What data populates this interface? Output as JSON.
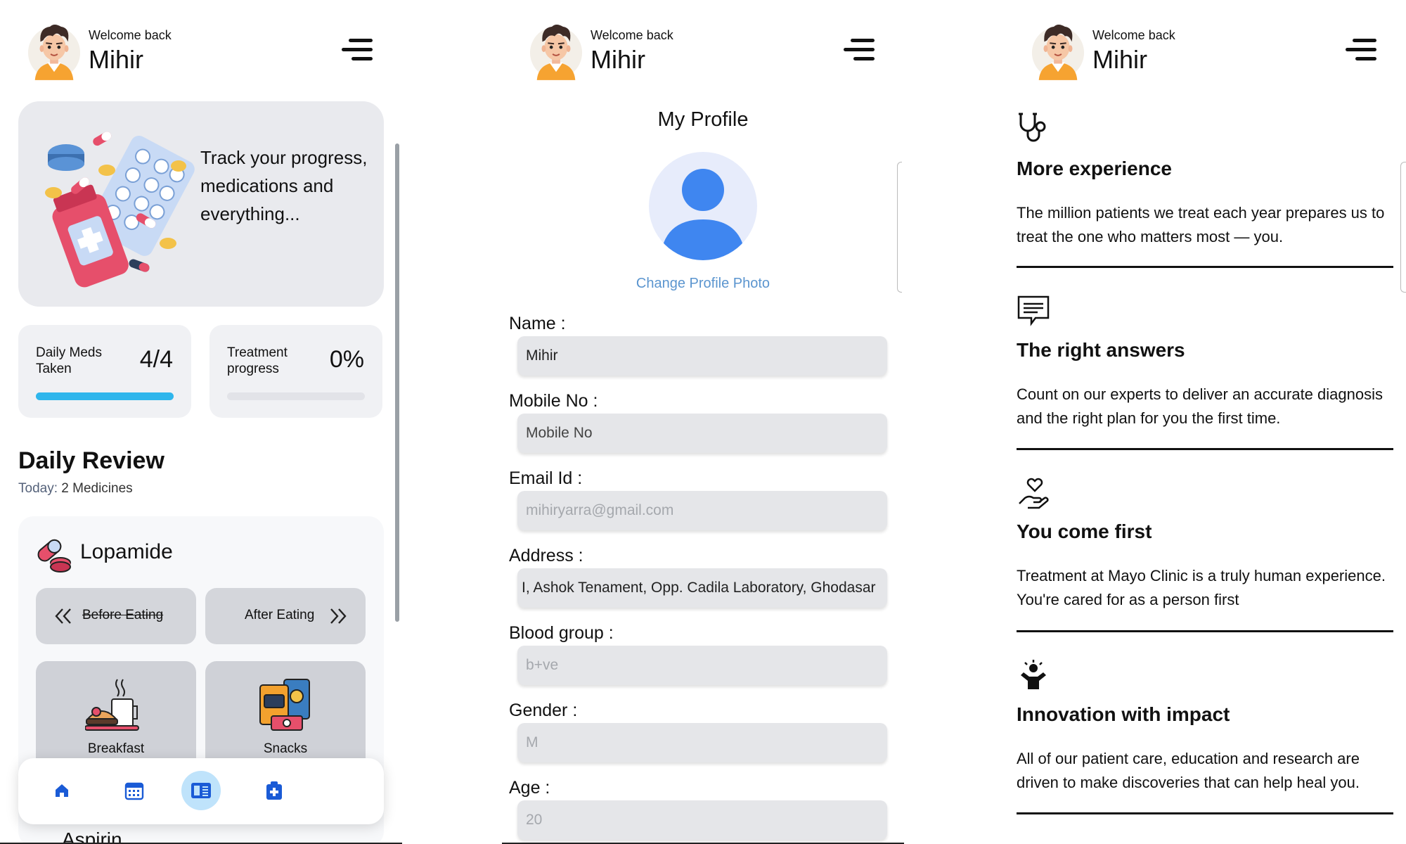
{
  "header": {
    "welcome": "Welcome back",
    "user_name": "Mihir"
  },
  "home": {
    "hero_text": "Track your progress, medications and everything...",
    "daily_meds": {
      "label": "Daily Meds Taken",
      "value": "4/4",
      "progress": 1.0
    },
    "treatment": {
      "label": "Treatment progress",
      "value": "0%",
      "progress": 0.0
    },
    "daily_review": {
      "title": "Daily Review",
      "today_label": "Today:",
      "today_value": "2 Medicines"
    },
    "medicine": {
      "name": "Lopamide",
      "before_eating": "Before Eating",
      "after_eating": "After Eating",
      "meals": [
        "Breakfast",
        "Snacks"
      ]
    },
    "next_medicine": "Aspirin",
    "nav": {
      "items": [
        "home-icon",
        "calendar-icon",
        "book-icon",
        "medical-kit-icon"
      ],
      "active": 2
    }
  },
  "profile": {
    "title": "My Profile",
    "change_photo": "Change Profile Photo",
    "fields": {
      "name": {
        "label": "Name :",
        "value": "Mihir"
      },
      "mobile": {
        "label": "Mobile No :",
        "placeholder": "Mobile No"
      },
      "email": {
        "label": "Email Id :",
        "value": "mihiryarra@gmail.com"
      },
      "address": {
        "label": "Address :",
        "value": "I, Ashok Tenament, Opp. Cadila Laboratory, Ghodasar"
      },
      "blood": {
        "label": "Blood group :",
        "value": "b+ve"
      },
      "gender": {
        "label": "Gender :",
        "value": "M"
      },
      "age": {
        "label": "Age :",
        "value": "20"
      }
    }
  },
  "about": {
    "features": [
      {
        "icon": "stethoscope-icon",
        "title": "More experience",
        "text": "The million patients we treat each year prepares us to treat the one who matters most — you."
      },
      {
        "icon": "chat-icon",
        "title": "The right answers",
        "text": "Count on our experts to deliver an accurate diagnosis and the right plan for you the first time."
      },
      {
        "icon": "heart-hand-icon",
        "title": "You come first",
        "text": "Treatment at Mayo Clinic is a truly human experience. You're cared for as a person first"
      },
      {
        "icon": "innovation-icon",
        "title": "Innovation with impact",
        "text": "All of our patient care, education and research are driven to make discoveries that can help heal you."
      }
    ]
  },
  "colors": {
    "accent": "#2fb6ec",
    "link": "#5b95cf",
    "nav_active": "#bfe3fb",
    "nav_icon": "#1a5bd6"
  }
}
